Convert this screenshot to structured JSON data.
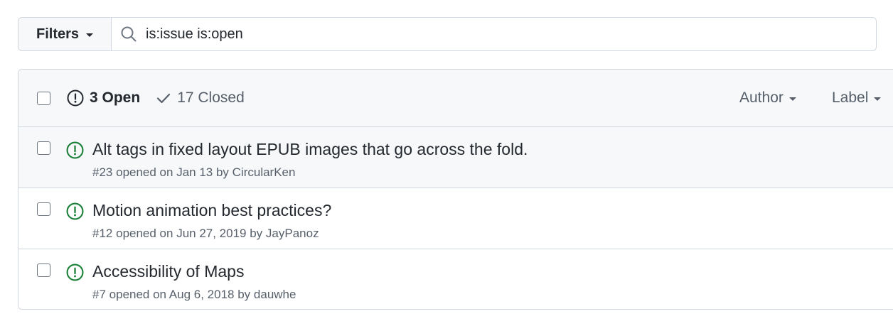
{
  "filter_bar": {
    "filters_label": "Filters",
    "search_value": "is:issue is:open"
  },
  "issues_header": {
    "open_label": "3 Open",
    "closed_label": "17 Closed",
    "author_filter": "Author",
    "label_filter": "Label"
  },
  "issues": [
    {
      "title": "Alt tags in fixed layout EPUB images that go across the fold.",
      "number": "#23",
      "opened_text": "opened on Jan 13 by",
      "author": "CircularKen"
    },
    {
      "title": "Motion animation best practices?",
      "number": "#12",
      "opened_text": "opened on Jun 27, 2019 by",
      "author": "JayPanoz"
    },
    {
      "title": "Accessibility of Maps",
      "number": "#7",
      "opened_text": "opened on Aug 6, 2018 by",
      "author": "dauwhe"
    }
  ],
  "colors": {
    "open_icon": "#1a7f37",
    "border": "#d0d7de",
    "header_bg": "#f6f8fa",
    "muted_text": "#57606a"
  },
  "icons": {
    "search": "search-icon",
    "open_state": "issue-opened-icon",
    "closed_state": "check-icon",
    "dropdown": "caret-down-icon"
  }
}
